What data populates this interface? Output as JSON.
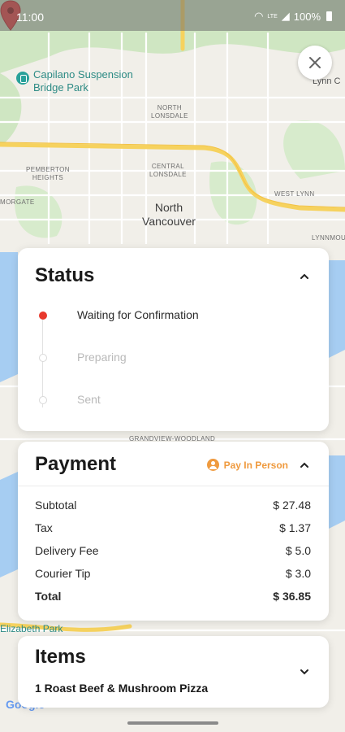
{
  "statusbar": {
    "time": "11:00",
    "signal": "LTE",
    "battery": "100%"
  },
  "map": {
    "poi": "Capilano Suspension\nBridge Park",
    "labels": {
      "north_lonsdale": "NORTH\nLONSDALE",
      "central_lonsdale": "CENTRAL\nLONSDALE",
      "pemberton": "PEMBERTON\nHEIGHTS",
      "morgate": "MORGATE",
      "west_lynn": "WEST LYNN",
      "lynnmour": "LYNNMOU",
      "lynn": "Lynn C",
      "grandview": "GRANDVIEW-WOODLAND",
      "park": "Elizabeth Park",
      "city": "North\nVancouver"
    },
    "logo": "Google"
  },
  "close_icon": "close-icon",
  "status": {
    "title": "Status",
    "steps": [
      {
        "label": "Waiting for Confirmation",
        "state": "active"
      },
      {
        "label": "Preparing",
        "state": "idle"
      },
      {
        "label": "Sent",
        "state": "idle"
      }
    ]
  },
  "payment": {
    "title": "Payment",
    "mode": "Pay In Person",
    "rows": [
      {
        "label": "Subtotal",
        "value": "$ 27.48"
      },
      {
        "label": "Tax",
        "value": "$ 1.37"
      },
      {
        "label": "Delivery Fee",
        "value": "$ 5.0"
      },
      {
        "label": "Courier Tip",
        "value": "$ 3.0"
      },
      {
        "label": "Total",
        "value": "$ 36.85"
      }
    ]
  },
  "items": {
    "title": "Items",
    "list": [
      "1 Roast Beef & Mushroom Pizza"
    ]
  },
  "colors": {
    "accent": "#e8392d",
    "pay_mode": "#ef9a3e"
  }
}
